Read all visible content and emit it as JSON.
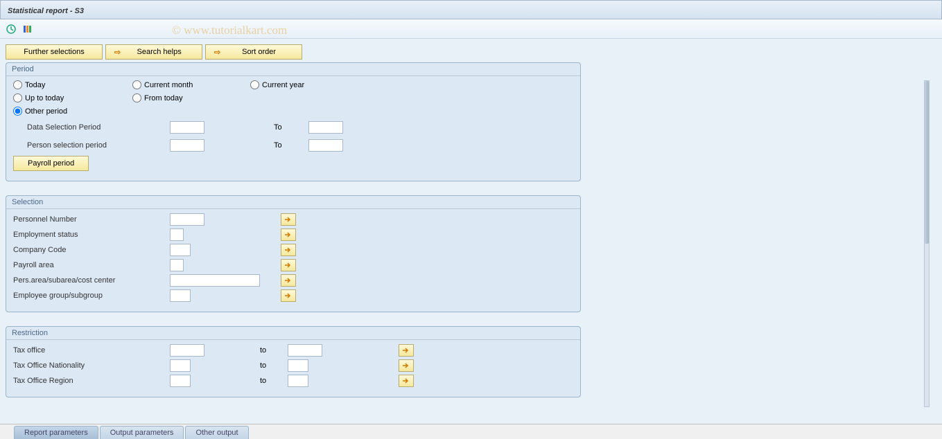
{
  "title": "Statistical report - S3",
  "watermark": "© www.tutorialkart.com",
  "toolbar": {
    "execute_icon": "execute",
    "variants_icon": "variants"
  },
  "actionButtons": {
    "further_selections": "Further selections",
    "search_helps": "Search helps",
    "sort_order": "Sort order"
  },
  "period": {
    "group_title": "Period",
    "radios": {
      "today": "Today",
      "current_month": "Current month",
      "current_year": "Current year",
      "up_to_today": "Up to today",
      "from_today": "From today",
      "other_period": "Other period"
    },
    "selected": "other_period",
    "data_selection_label": "Data Selection Period",
    "data_selection_from": "",
    "data_selection_to_label": "To",
    "data_selection_to": "",
    "person_selection_label": "Person selection period",
    "person_selection_from": "",
    "person_selection_to_label": "To",
    "person_selection_to": "",
    "payroll_period_btn": "Payroll period"
  },
  "selection": {
    "group_title": "Selection",
    "rows": [
      {
        "label": "Personnel Number",
        "width": "w50",
        "value": ""
      },
      {
        "label": "Employment status",
        "width": "w20",
        "value": ""
      },
      {
        "label": "Company Code",
        "width": "w30",
        "value": ""
      },
      {
        "label": "Payroll area",
        "width": "w20",
        "value": ""
      },
      {
        "label": "Pers.area/subarea/cost center",
        "width": "w120",
        "value": ""
      },
      {
        "label": "Employee group/subgroup",
        "width": "w30",
        "value": ""
      }
    ]
  },
  "restriction": {
    "group_title": "Restriction",
    "to_label": "to",
    "rows": [
      {
        "label": "Tax office",
        "from_width": "w50",
        "to_width": "w50",
        "from": "",
        "to": ""
      },
      {
        "label": "Tax Office Nationality",
        "from_width": "w30",
        "to_width": "w30",
        "from": "",
        "to": ""
      },
      {
        "label": "Tax Office Region",
        "from_width": "w30",
        "to_width": "w30",
        "from": "",
        "to": ""
      }
    ]
  },
  "tabs": {
    "active": 0,
    "items": [
      "Report parameters",
      "Output parameters",
      "Other output"
    ]
  }
}
